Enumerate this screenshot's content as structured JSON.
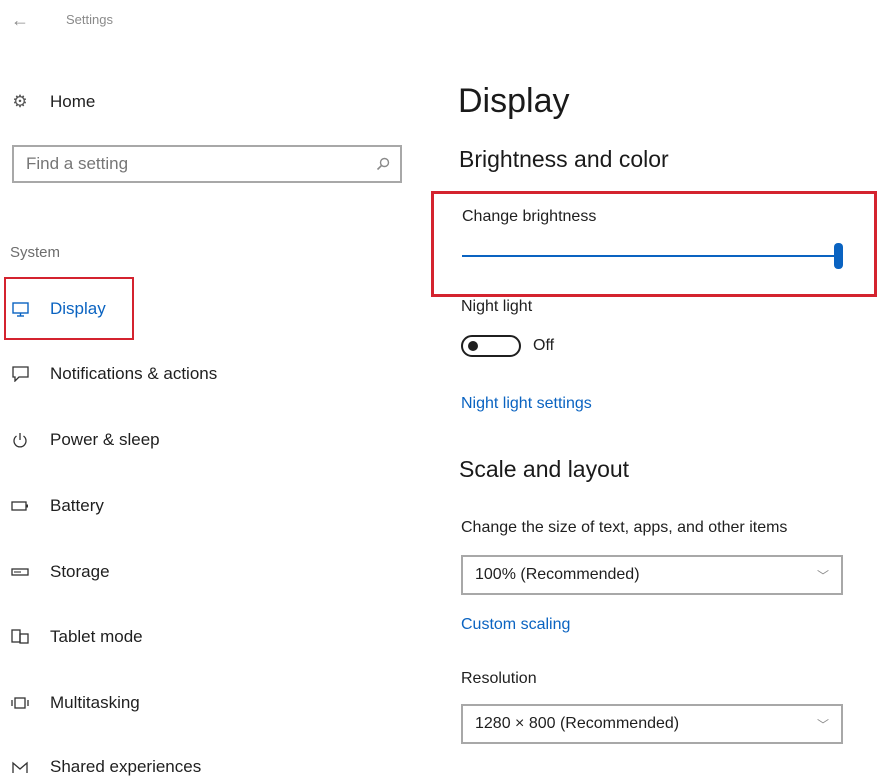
{
  "window": {
    "title": "Settings"
  },
  "sidebar": {
    "home_label": "Home",
    "search_placeholder": "Find a setting",
    "section_label": "System",
    "items": [
      {
        "label": "Display",
        "icon": "monitor-icon",
        "active": true
      },
      {
        "label": "Notifications & actions",
        "icon": "notifications-icon"
      },
      {
        "label": "Power & sleep",
        "icon": "power-icon"
      },
      {
        "label": "Battery",
        "icon": "battery-icon"
      },
      {
        "label": "Storage",
        "icon": "storage-icon"
      },
      {
        "label": "Tablet mode",
        "icon": "tablet-mode-icon"
      },
      {
        "label": "Multitasking",
        "icon": "multitasking-icon"
      },
      {
        "label": "Shared experiences",
        "icon": "shared-experiences-icon"
      }
    ]
  },
  "main": {
    "title": "Display",
    "brightness_section": {
      "heading": "Brightness and color",
      "brightness_label": "Change brightness",
      "brightness_value": 100,
      "night_light_label": "Night light",
      "night_light_state": "Off",
      "night_light_link": "Night light settings"
    },
    "scale_section": {
      "heading": "Scale and layout",
      "scale_description": "Change the size of text, apps, and other items",
      "scale_value": "100% (Recommended)",
      "custom_scaling_link": "Custom scaling",
      "resolution_label": "Resolution",
      "resolution_value": "1280 × 800 (Recommended)"
    }
  },
  "colors": {
    "accent": "#0a63c1",
    "highlight": "#d4232f"
  }
}
